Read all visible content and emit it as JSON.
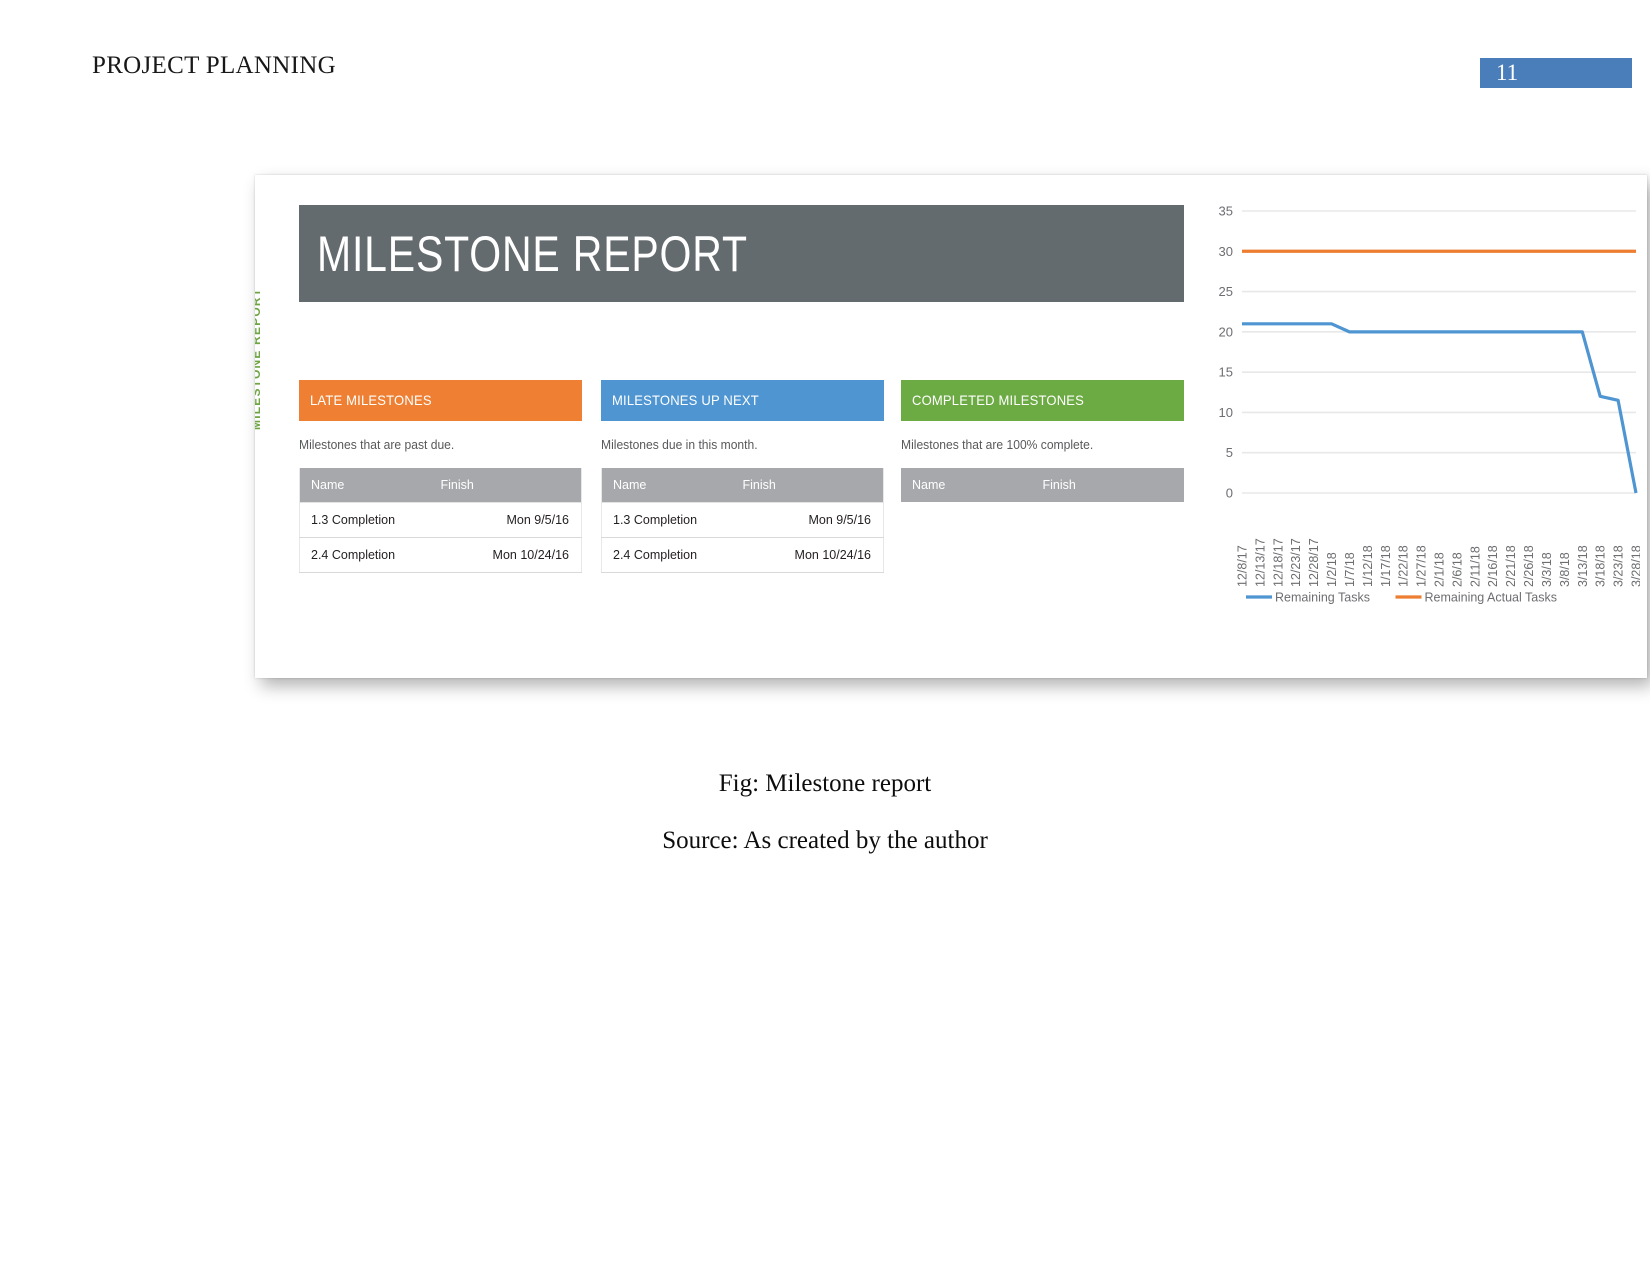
{
  "document": {
    "header_title": "PROJECT PLANNING",
    "page_number": "11",
    "page_number_color": "#4a7ebb",
    "caption": "Fig: Milestone report",
    "source": "Source: As created by the author"
  },
  "report": {
    "side_label": "MILESTONE REPORT",
    "title": "MILESTONE REPORT",
    "title_bar_color": "#646b6e",
    "columns": [
      {
        "heading": "LATE MILESTONES",
        "heading_color": "#ef8033",
        "description": "Milestones that are past due.",
        "table": {
          "headers": [
            "Name",
            "Finish"
          ],
          "rows": [
            [
              "1.3 Completion",
              "Mon 9/5/16"
            ],
            [
              "2.4 Completion",
              "Mon 10/24/16"
            ]
          ]
        }
      },
      {
        "heading": "MILESTONES UP NEXT",
        "heading_color": "#4e95d2",
        "description": "Milestones due in this month.",
        "table": {
          "headers": [
            "Name",
            "Finish"
          ],
          "rows": [
            [
              "1.3 Completion",
              "Mon 9/5/16"
            ],
            [
              "2.4 Completion",
              "Mon 10/24/16"
            ]
          ]
        }
      },
      {
        "heading": "COMPLETED MILESTONES",
        "heading_color": "#6cab43",
        "description": "Milestones that are 100% complete.",
        "table": {
          "headers": [
            "Name",
            "Finish"
          ],
          "rows": []
        }
      }
    ]
  },
  "chart_data": {
    "type": "line",
    "title": "",
    "xlabel": "",
    "ylabel": "",
    "ylim": [
      0,
      35
    ],
    "yticks": [
      0,
      5,
      10,
      15,
      20,
      25,
      30,
      35
    ],
    "grid": true,
    "legend_position": "bottom",
    "categories": [
      "12/8/17",
      "12/13/17",
      "12/18/17",
      "12/23/17",
      "12/28/17",
      "1/2/18",
      "1/7/18",
      "1/12/18",
      "1/17/18",
      "1/22/18",
      "1/27/18",
      "2/1/18",
      "2/6/18",
      "2/11/18",
      "2/16/18",
      "2/21/18",
      "2/26/18",
      "3/3/18",
      "3/8/18",
      "3/13/18",
      "3/18/18",
      "3/23/18",
      "3/28/18"
    ],
    "series": [
      {
        "name": "Remaining Tasks",
        "color": "#4e95d2",
        "values": [
          21,
          21,
          21,
          21,
          21,
          21,
          20,
          20,
          20,
          20,
          20,
          20,
          20,
          20,
          20,
          20,
          20,
          20,
          20,
          20,
          12,
          11.5,
          0
        ]
      },
      {
        "name": "Remaining Actual Tasks",
        "color": "#ed7d31",
        "values": [
          30,
          30,
          30,
          30,
          30,
          30,
          30,
          30,
          30,
          30,
          30,
          30,
          30,
          30,
          30,
          30,
          30,
          30,
          30,
          30,
          30,
          30,
          30
        ]
      }
    ]
  }
}
